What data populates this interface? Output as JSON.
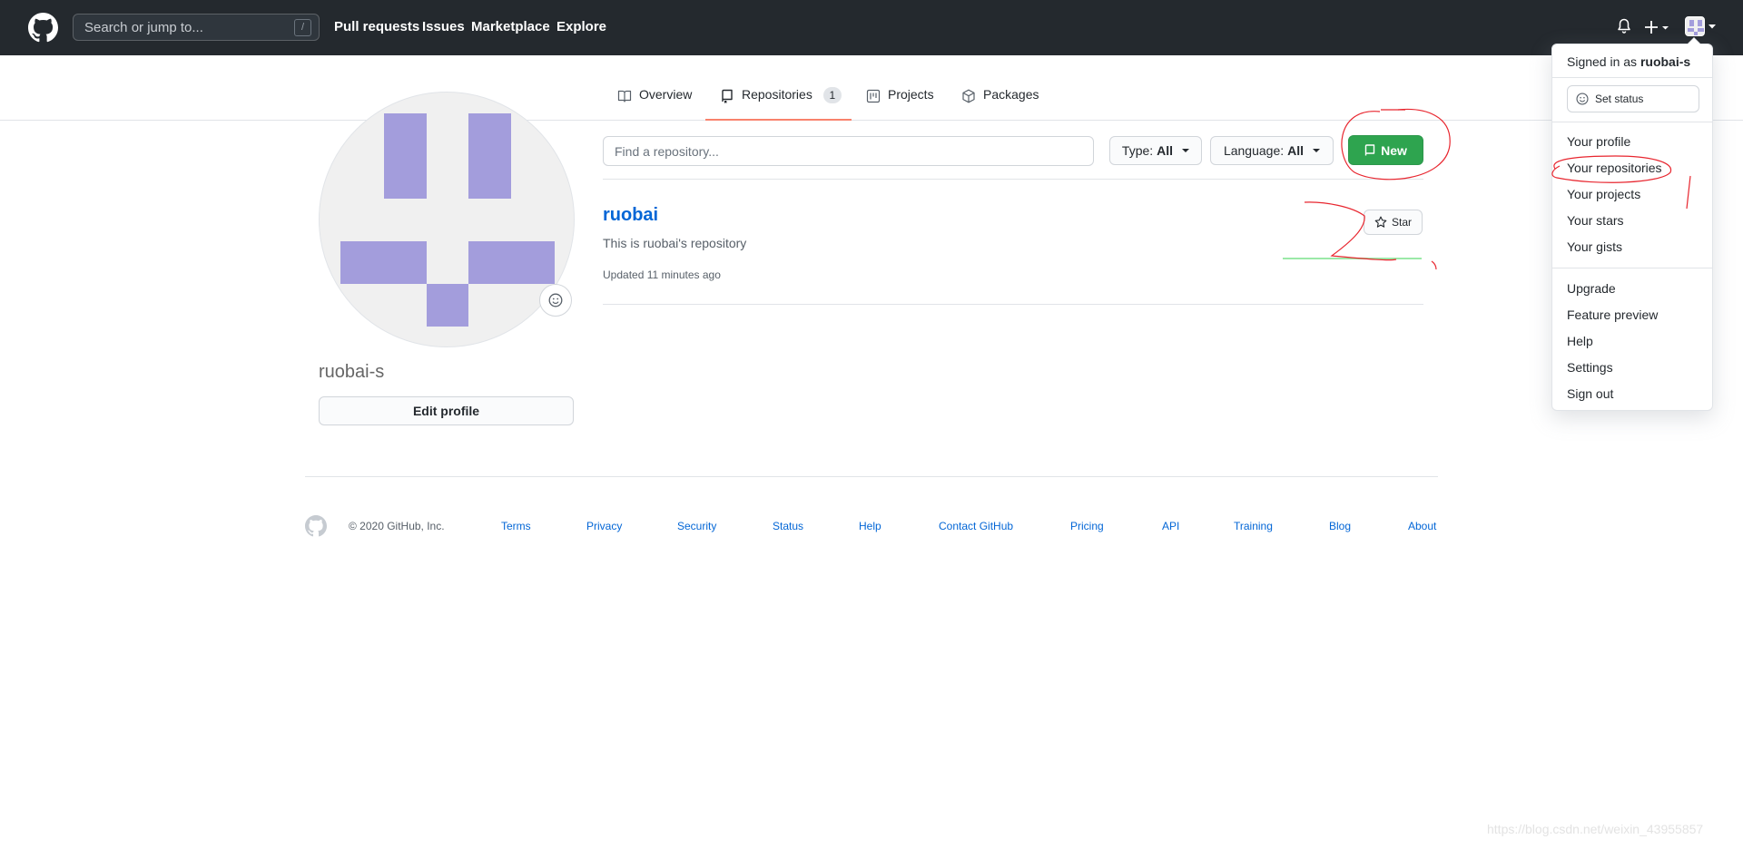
{
  "header": {
    "search_placeholder": "Search or jump to...",
    "search_shortcut": "/",
    "nav": [
      "Pull requests",
      "Issues",
      "Marketplace",
      "Explore"
    ]
  },
  "profile": {
    "username": "ruobai-s",
    "edit_label": "Edit profile",
    "avatar_color": "#a39ddc"
  },
  "tabs": [
    {
      "label": "Overview",
      "icon": "book-icon"
    },
    {
      "label": "Repositories",
      "icon": "repo-icon",
      "count": "1"
    },
    {
      "label": "Projects",
      "icon": "project-icon"
    },
    {
      "label": "Packages",
      "icon": "package-icon"
    }
  ],
  "filters": {
    "find_placeholder": "Find a repository...",
    "type_label": "Type:",
    "type_value": "All",
    "language_label": "Language:",
    "language_value": "All",
    "new_label": "New"
  },
  "repo": {
    "name": "ruobai",
    "description": "This is ruobai's repository",
    "updated": "Updated 11 minutes ago",
    "star_label": "Star"
  },
  "footer": {
    "copyright": "© 2020 GitHub, Inc.",
    "links": [
      "Terms",
      "Privacy",
      "Security",
      "Status",
      "Help",
      "Contact GitHub",
      "Pricing",
      "API",
      "Training",
      "Blog",
      "About"
    ]
  },
  "dropdown": {
    "signed_in_prefix": "Signed in as",
    "signed_in_user": "ruobai-s",
    "set_status": "Set status",
    "group1": [
      "Your profile",
      "Your repositories",
      "Your projects",
      "Your stars",
      "Your gists"
    ],
    "group2": [
      "Upgrade",
      "Feature preview",
      "Help",
      "Settings",
      "Sign out"
    ]
  },
  "watermark": "https://blog.csdn.net/weixin_43955857",
  "colors": {
    "header_bg": "#24292e",
    "accent_green": "#2ea44f",
    "link_blue": "#0366d6",
    "tab_underline": "#f9826c",
    "annotation_red": "#e8262f"
  }
}
